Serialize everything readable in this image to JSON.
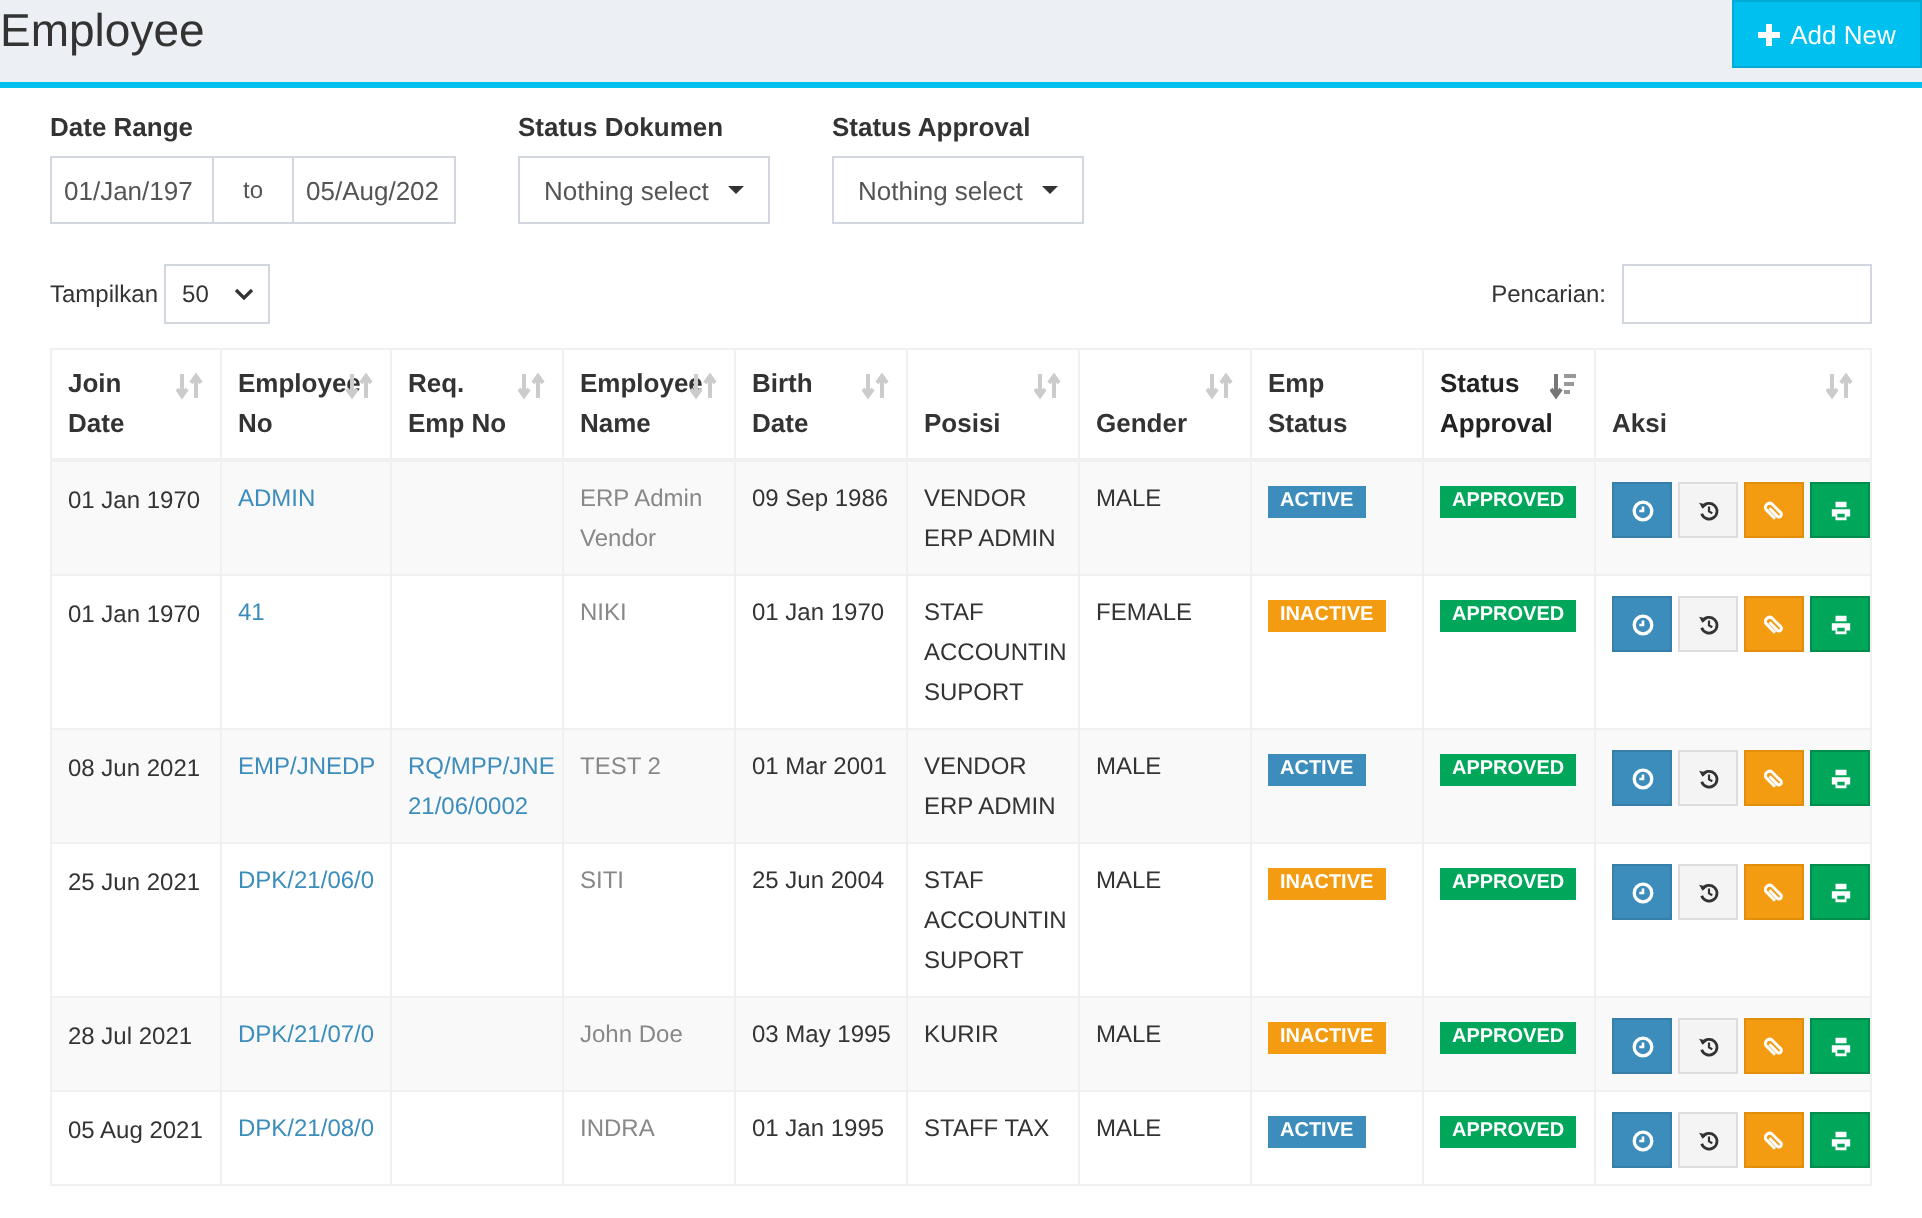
{
  "header": {
    "title": "Employee",
    "add_button": "Add New"
  },
  "filters": {
    "date_range": {
      "label": "Date Range",
      "from": "01/Jan/197",
      "separator": "to",
      "to": "05/Aug/202"
    },
    "status_dokumen": {
      "label": "Status Dokumen",
      "value": "Nothing select"
    },
    "status_approval": {
      "label": "Status Approval",
      "value": "Nothing select"
    }
  },
  "length": {
    "label": "Tampilkan",
    "value": "50"
  },
  "search": {
    "label": "Pencarian:"
  },
  "table": {
    "columns": [
      {
        "label": "Join Date",
        "sortable": true,
        "sorted": false
      },
      {
        "label": "Employee No",
        "sortable": true,
        "sorted": false
      },
      {
        "label": "Req. Emp No",
        "sortable": true,
        "sorted": false
      },
      {
        "label": "Employee Name",
        "sortable": true,
        "sorted": false
      },
      {
        "label": "Birth Date",
        "sortable": true,
        "sorted": false
      },
      {
        "label": "Posisi",
        "sortable": true,
        "sorted": false
      },
      {
        "label": "Gender",
        "sortable": true,
        "sorted": false
      },
      {
        "label": "Emp Status",
        "sortable": false,
        "sorted": false
      },
      {
        "label": "Status Approval",
        "sortable": true,
        "sorted": true
      },
      {
        "label": "Aksi",
        "sortable": true,
        "sorted": false
      }
    ],
    "rows": [
      {
        "join_date": "01 Jan 1970",
        "employee_no": "ADMIN",
        "req_emp_no": "",
        "employee_name": "ERP Admin Vendor",
        "birth_date": "09 Sep 1986",
        "posisi": "VENDOR ERP ADMIN",
        "gender": "MALE",
        "emp_status": {
          "label": "ACTIVE",
          "kind": "active"
        },
        "status_approval": {
          "label": "APPROVED",
          "kind": "approved"
        }
      },
      {
        "join_date": "01 Jan 1970",
        "employee_no": "41",
        "req_emp_no": "",
        "employee_name": "NIKI",
        "birth_date": "01 Jan 1970",
        "posisi": "STAF ACCOUNTIN SUPORT",
        "gender": "FEMALE",
        "emp_status": {
          "label": "INACTIVE",
          "kind": "inactive"
        },
        "status_approval": {
          "label": "APPROVED",
          "kind": "approved"
        }
      },
      {
        "join_date": "08 Jun 2021",
        "employee_no": "EMP/JNEDP",
        "req_emp_no": "RQ/MPP/JNE 21/06/0002",
        "employee_name": "TEST 2",
        "birth_date": "01 Mar 2001",
        "posisi": "VENDOR ERP ADMIN",
        "gender": "MALE",
        "emp_status": {
          "label": "ACTIVE",
          "kind": "active"
        },
        "status_approval": {
          "label": "APPROVED",
          "kind": "approved"
        }
      },
      {
        "join_date": "25 Jun 2021",
        "employee_no": "DPK/21/06/0",
        "req_emp_no": "",
        "employee_name": "SITI",
        "birth_date": "25 Jun 2004",
        "posisi": "STAF ACCOUNTIN SUPORT",
        "gender": "MALE",
        "emp_status": {
          "label": "INACTIVE",
          "kind": "inactive"
        },
        "status_approval": {
          "label": "APPROVED",
          "kind": "approved"
        }
      },
      {
        "join_date": "28 Jul 2021",
        "employee_no": "DPK/21/07/0",
        "req_emp_no": "",
        "employee_name": "John Doe",
        "birth_date": "03 May 1995",
        "posisi": "KURIR",
        "gender": "MALE",
        "emp_status": {
          "label": "INACTIVE",
          "kind": "inactive"
        },
        "status_approval": {
          "label": "APPROVED",
          "kind": "approved"
        }
      },
      {
        "join_date": "05 Aug 2021",
        "employee_no": "DPK/21/08/0",
        "req_emp_no": "",
        "employee_name": "INDRA",
        "birth_date": "01 Jan 1995",
        "posisi": "STAFF TAX",
        "gender": "MALE",
        "emp_status": {
          "label": "ACTIVE",
          "kind": "active"
        },
        "status_approval": {
          "label": "APPROVED",
          "kind": "approved"
        }
      }
    ]
  }
}
